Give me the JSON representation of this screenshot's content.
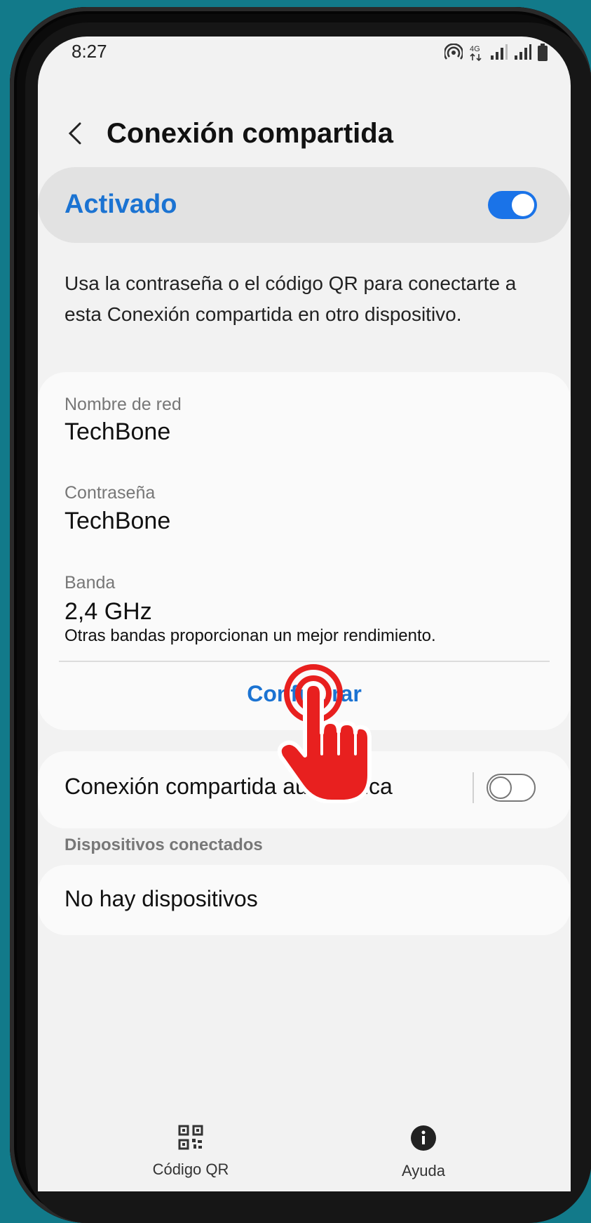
{
  "status_bar": {
    "time": "8:27",
    "icons": [
      "hotspot-icon",
      "4g-icon",
      "signal-icon",
      "signal-icon",
      "battery-icon"
    ]
  },
  "header": {
    "title": "Conexión compartida",
    "back_icon": "chevron-left-icon"
  },
  "master_switch": {
    "label": "Activado",
    "state": "on",
    "accent": "#1a73e8"
  },
  "description": "Usa la contraseña o el código QR para conectarte a esta Conexión compartida en otro dispositivo.",
  "settings": {
    "network_name": {
      "label": "Nombre de red",
      "value": "TechBone"
    },
    "password": {
      "label": "Contraseña",
      "value": "TechBone"
    },
    "band": {
      "label": "Banda",
      "value": "2,4 GHz",
      "note": "Otras bandas proporcionan un mejor rendimiento."
    },
    "configure_label": "Configurar"
  },
  "auto_hotspot": {
    "label": "Conexión compartida automática",
    "state": "off"
  },
  "devices": {
    "section_label": "Dispositivos conectados",
    "empty_label": "No hay dispositivos"
  },
  "bottom_bar": {
    "items": [
      {
        "icon": "qr-code-icon",
        "label": "Código QR"
      },
      {
        "icon": "info-icon",
        "label": "Ayuda"
      }
    ]
  },
  "overlay": {
    "icon": "tap-hand-icon",
    "color": "#e8201f"
  }
}
